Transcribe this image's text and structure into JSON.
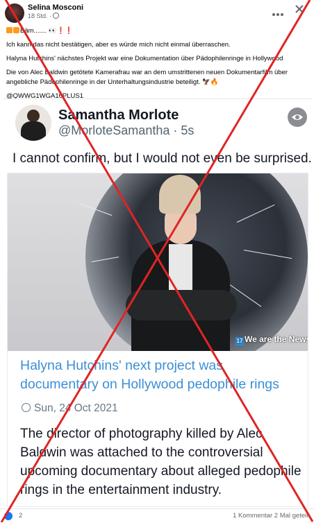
{
  "post": {
    "author": "Selina Mosconi",
    "time": "18 Std. ·",
    "lines": [
      "Bäm....... 👀❗❗",
      "Ich kann das nicht bestätigen, aber es würde mich nicht einmal überraschen.",
      "Halyna Hutchins' nächstes Projekt war eine Dokumentation über Pädophilenringe in Hollywood",
      "Die von Alec Baldwin getötete Kamerafrau war an dem umstrittenen neuen Dokumentarfilm über",
      "angebliche Pädophilenringe in der Unterhaltungsindustrie beteiligt. 🦅🔥",
      "@QWWG1WGA16PLUS1"
    ]
  },
  "tweet": {
    "name": "Samantha Morlote",
    "handle": "@MorloteSamantha · 5s",
    "text": "I cannot confirm, but I would not even be surprised."
  },
  "article": {
    "logo_badge": "17",
    "logo_text": "We are the News",
    "title": "Halyna Hutchins' next project was documentary on Hollywood pedophile rings",
    "date": "Sun, 24 Oct 2021",
    "body": "The director of photography killed by Alec Baldwin was attached to the controversial upcoming documentary about alleged pedophile rings in the entertainment industry."
  },
  "footer": {
    "reactions": "2",
    "stats": "1 Kommentar  2 Mal geteilt"
  },
  "colors": {
    "overlay_x": "#e02424",
    "link": "#3b8fd6",
    "handle": "#536471"
  },
  "icons": [
    "globe-icon",
    "more-icon",
    "close-icon",
    "eye-icon",
    "clock-icon",
    "reaction-icon"
  ]
}
